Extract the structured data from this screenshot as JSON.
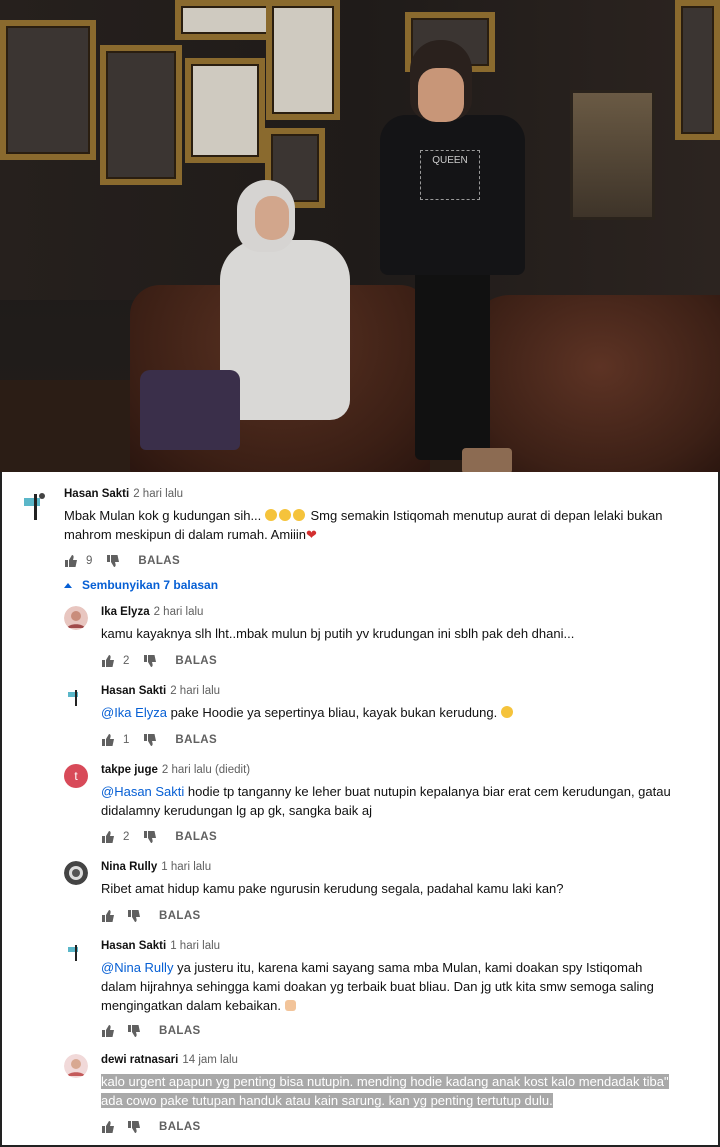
{
  "comments": [
    {
      "author": "Hasan Sakti",
      "time": "2 hari lalu",
      "text_before_emoji": "Mbak Mulan kok g kudungan sih... ",
      "text_after_emoji": " Smg semakin Istiqomah menutup aurat di depan lelaki bukan mahrom meskipun di dalam rumah. Amiiin",
      "likes": "9",
      "reply_label": "BALAS",
      "avatar_icon": "hasan-sakti-avatar"
    }
  ],
  "toggle_replies": "Sembunyikan 7 balasan",
  "replies": [
    {
      "author": "Ika Elyza",
      "time": "2 hari lalu",
      "mention": "",
      "text": "kamu kayaknya slh lht..mbak mulun bj putih yv krudungan ini sblh pak deh dhani...",
      "likes": "2",
      "reply_label": "BALAS"
    },
    {
      "author": "Hasan Sakti",
      "time": "2 hari lalu",
      "mention": "@Ika Elyza",
      "text": " pake Hoodie ya sepertinya bliau, kayak bukan kerudung. ",
      "likes": "1",
      "reply_label": "BALAS"
    },
    {
      "author": "takpe juge",
      "time": "2 hari lalu (diedit)",
      "mention": "@Hasan Sakti",
      "text": " hodie tp tanganny ke leher buat nutupin kepalanya biar erat cem kerudungan, gatau didalamny kerudungan lg ap gk, sangka baik aj",
      "likes": "2",
      "reply_label": "BALAS",
      "avatar_letter": "t"
    },
    {
      "author": "Nina Rully",
      "time": "1 hari lalu",
      "mention": "",
      "text": "Ribet amat hidup kamu pake ngurusin kerudung segala, padahal kamu laki kan?",
      "likes": "",
      "reply_label": "BALAS"
    },
    {
      "author": "Hasan Sakti",
      "time": "1 hari lalu",
      "mention": "@Nina Rully",
      "text": " ya justeru itu, karena kami sayang sama mba Mulan, kami doakan spy Istiqomah dalam hijrahnya sehingga kami doakan yg terbaik buat bliau. Dan jg utk kita smw semoga saling mengingatkan dalam kebaikan. ",
      "likes": "",
      "reply_label": "BALAS"
    },
    {
      "author": "dewi ratnasari",
      "time": "14 jam lalu",
      "mention": "",
      "text": "kalo urgent apapun yg penting bisa nutupin. mending hodie kadang anak kost kalo mendadak tiba\" ada cowo pake tutupan handuk atau kain sarung. kan yg penting tertutup dulu.",
      "likes": "",
      "reply_label": "BALAS"
    }
  ],
  "video": {
    "shirt_text": "QUEEN"
  },
  "colors": {
    "link": "#065fd4",
    "muted": "#606060",
    "highlight": "#a9a9a9"
  }
}
